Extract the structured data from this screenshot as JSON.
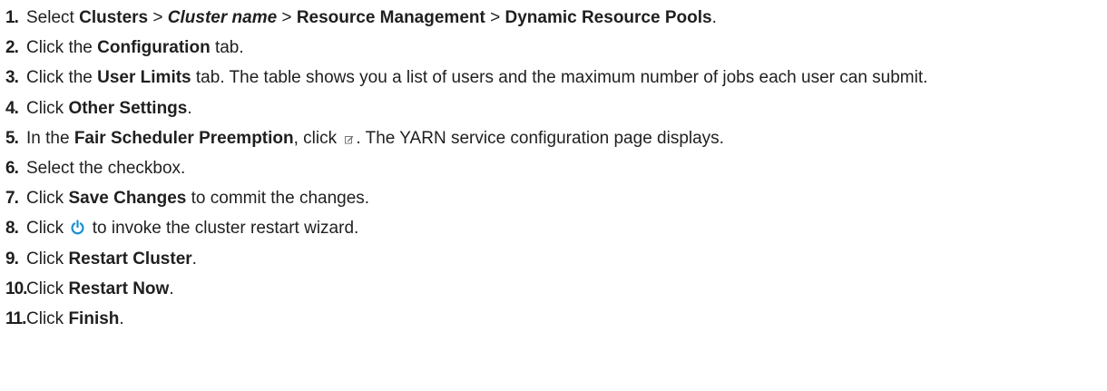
{
  "steps": [
    {
      "num": "1.",
      "t1": "Select ",
      "b1": "Clusters",
      "t2": " > ",
      "bi1": "Cluster name",
      "t3": " > ",
      "b2": "Resource Management",
      "t4": " > ",
      "b3": "Dynamic Resource Pools",
      "t5": "."
    },
    {
      "num": "2.",
      "t1": "Click the ",
      "b1": "Configuration",
      "t2": " tab."
    },
    {
      "num": "3.",
      "t1": "Click the ",
      "b1": "User Limits",
      "t2": " tab. The table shows you a list of users and the maximum number of jobs each user can submit."
    },
    {
      "num": "4.",
      "t1": "Click ",
      "b1": "Other Settings",
      "t2": "."
    },
    {
      "num": "5.",
      "t1": "In the ",
      "b1": "Fair Scheduler Preemption",
      "t2": ", click ",
      "t3": ". The YARN service configuration page displays."
    },
    {
      "num": "6.",
      "t1": "Select the checkbox."
    },
    {
      "num": "7.",
      "t1": "Click ",
      "b1": "Save Changes",
      "t2": " to commit the changes."
    },
    {
      "num": "8.",
      "t1": "Click ",
      "t2": " to invoke the cluster restart wizard."
    },
    {
      "num": "9.",
      "t1": "Click ",
      "b1": "Restart Cluster",
      "t2": "."
    },
    {
      "num": "10.",
      "t1": "Click ",
      "b1": "Restart Now",
      "t2": "."
    },
    {
      "num": "11.",
      "t1": "Click ",
      "b1": "Finish",
      "t2": "."
    }
  ],
  "icons": {
    "edit": "edit-icon",
    "power": "power-icon",
    "power_color": "#1a8fd1"
  }
}
